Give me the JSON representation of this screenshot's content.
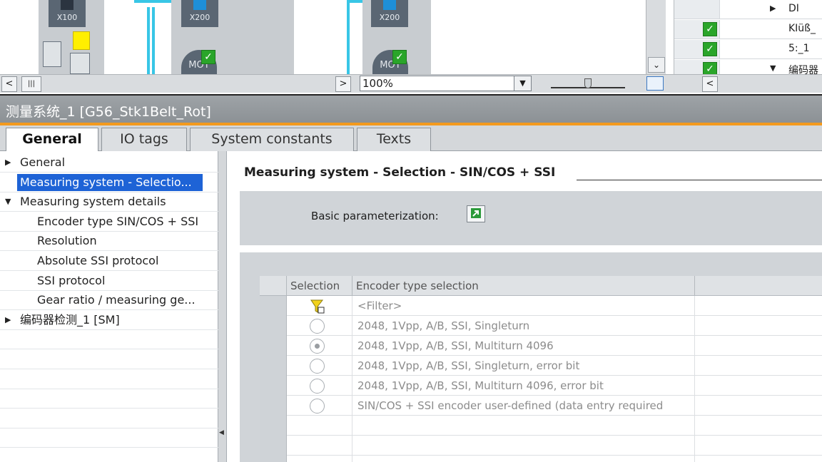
{
  "hardware_view": {
    "ports": [
      "X100",
      "X200",
      "X200"
    ],
    "motors": [
      "MOT",
      "MOT"
    ],
    "zoom": "100%",
    "zoom_fraction": 0.5
  },
  "right_list": {
    "rows": [
      {
        "text": "DI",
        "has_check": false,
        "expander": "▶"
      },
      {
        "text": "KIüß_",
        "has_check": true,
        "expander": ""
      },
      {
        "text": "5:_1",
        "has_check": true,
        "expander": ""
      },
      {
        "text": "编码器",
        "has_check": true,
        "expander": "▼"
      }
    ]
  },
  "inspector": {
    "title": "测量系统_1 [G56_Stk1Belt_Rot]",
    "tabs": [
      "General",
      "IO tags",
      "System constants",
      "Texts"
    ],
    "active_tab": "General"
  },
  "tree": {
    "items": [
      {
        "label": "General",
        "expander": "▶",
        "level": 0
      },
      {
        "label": "Measuring system - Selectio...",
        "expander": "",
        "level": 0,
        "selected": true
      },
      {
        "label": "Measuring system details",
        "expander": "▼",
        "level": 0
      },
      {
        "label": "Encoder type SIN/COS + SSI",
        "expander": "",
        "level": 1
      },
      {
        "label": "Resolution",
        "expander": "",
        "level": 1
      },
      {
        "label": "Absolute SSI protocol",
        "expander": "",
        "level": 1
      },
      {
        "label": "SSI protocol",
        "expander": "",
        "level": 1
      },
      {
        "label": "Gear ratio / measuring ge...",
        "expander": "",
        "level": 1
      },
      {
        "label": "编码器检测_1 [SM]",
        "expander": "▶",
        "level": 0
      }
    ]
  },
  "main": {
    "section_title": "Measuring system - Selection - SIN/COS + SSI",
    "basic_param_label": "Basic parameterization:",
    "grid": {
      "headers": [
        "Selection",
        "Encoder type selection"
      ],
      "filter_placeholder": "<Filter>",
      "rows": [
        {
          "label": "2048, 1Vpp, A/B, SSI, Singleturn",
          "selected": false
        },
        {
          "label": "2048, 1Vpp, A/B, SSI, Multiturn 4096",
          "selected": true
        },
        {
          "label": "2048, 1Vpp, A/B, SSI, Singleturn, error bit",
          "selected": false
        },
        {
          "label": "2048, 1Vpp, A/B, SSI, Multiturn 4096, error bit",
          "selected": false
        },
        {
          "label": "SIN/COS + SSI encoder user-defined (data entry required",
          "selected": false
        }
      ]
    }
  },
  "colors": {
    "accent_orange": "#f39a1e",
    "selection_blue": "#1e63d6",
    "check_green": "#2aa52a",
    "wire_cyan": "#38c6e6"
  }
}
